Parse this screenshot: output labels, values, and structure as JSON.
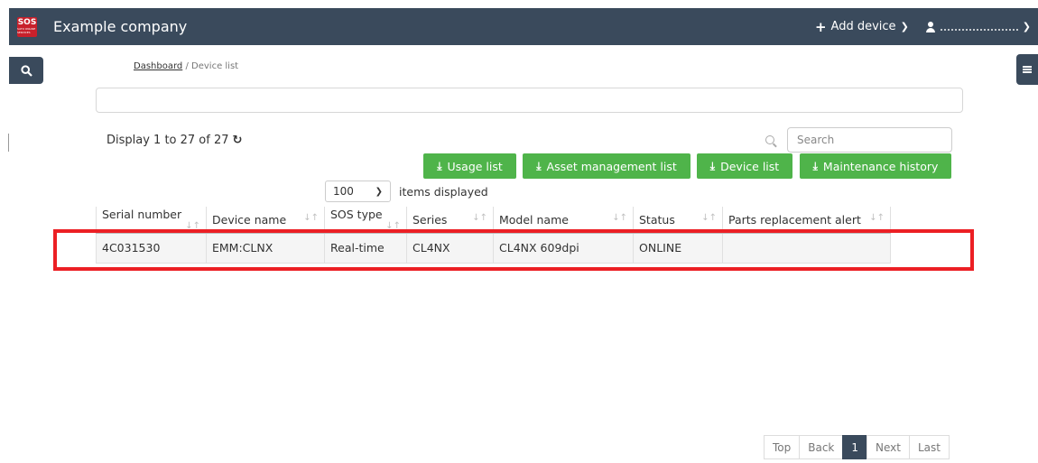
{
  "header": {
    "logo_text": "SOS",
    "logo_subtext": "SATO ONLINE SERVICES",
    "company": "Example company",
    "add_device_label": "Add device"
  },
  "breadcrumb": {
    "home": "Dashboard",
    "separator": "/",
    "current": "Device list"
  },
  "list": {
    "display_count": "Display 1 to 27 of 27"
  },
  "search": {
    "placeholder": "Search"
  },
  "buttons": {
    "usage_list": "Usage list",
    "asset_management_list": "Asset management list",
    "device_list": "Device list",
    "maintenance_history": "Maintenance history"
  },
  "per_page": {
    "value": "100",
    "suffix": "items displayed"
  },
  "table": {
    "columns": [
      "Serial number",
      "Device name",
      "SOS type",
      "Series",
      "Model name",
      "Status",
      "Parts replacement alert"
    ],
    "rows": [
      [
        "4C031530",
        "EMM:CLNX",
        "Real-time",
        "CL4NX",
        "CL4NX 609dpi",
        "ONLINE",
        ""
      ]
    ]
  },
  "pagination": {
    "top": "Top",
    "back": "Back",
    "current": "1",
    "next": "Next",
    "last": "Last"
  },
  "colors": {
    "nav_bg": "#3a4a5c",
    "button_green": "#4fb44a",
    "highlight_red": "#ec1f24",
    "logo_red": "#c8202b"
  }
}
